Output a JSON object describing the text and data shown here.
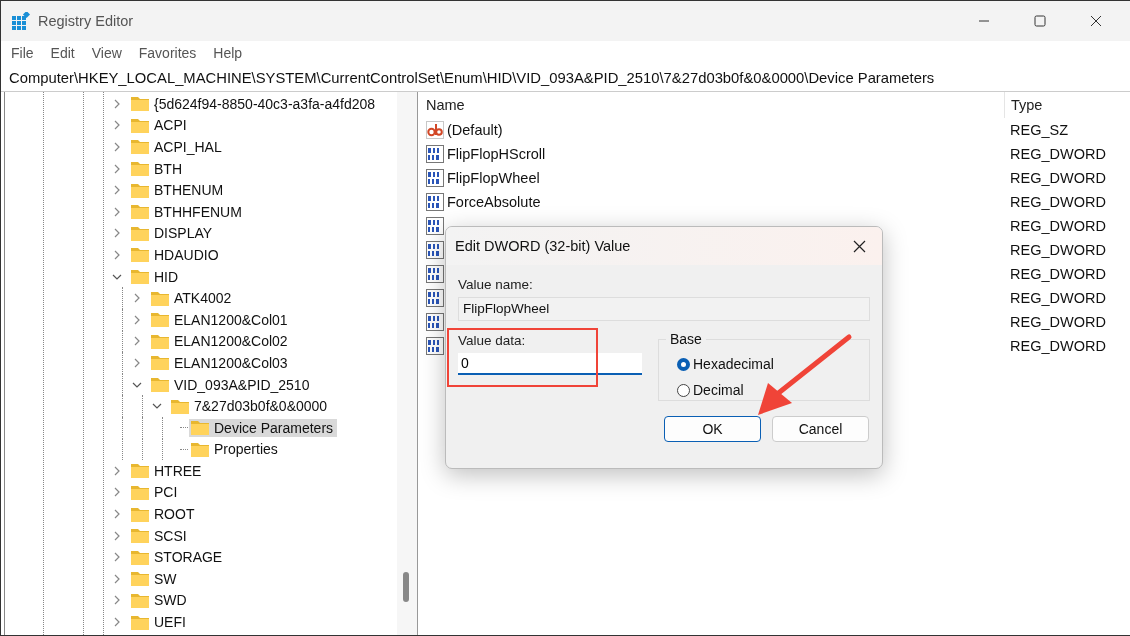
{
  "window": {
    "title": "Registry Editor"
  },
  "menu": [
    "File",
    "Edit",
    "View",
    "Favorites",
    "Help"
  ],
  "address": "Computer\\HKEY_LOCAL_MACHINE\\SYSTEM\\CurrentControlSet\\Enum\\HID\\VID_093A&PID_2510\\7&27d03b0f&0&0000\\Device Parameters",
  "tree": [
    {
      "label": "{5d624f94-8850-40c3-a3fa-a4fd208",
      "expanded": false,
      "selected": false
    },
    {
      "label": "ACPI",
      "expanded": false,
      "selected": false
    },
    {
      "label": "ACPI_HAL",
      "expanded": false,
      "selected": false
    },
    {
      "label": "BTH",
      "expanded": false,
      "selected": false
    },
    {
      "label": "BTHENUM",
      "expanded": false,
      "selected": false
    },
    {
      "label": "BTHHFENUM",
      "expanded": false,
      "selected": false
    },
    {
      "label": "DISPLAY",
      "expanded": false,
      "selected": false
    },
    {
      "label": "HDAUDIO",
      "expanded": false,
      "selected": false
    },
    {
      "label": "HID",
      "expanded": true,
      "selected": false,
      "children": [
        {
          "label": "ATK4002",
          "expanded": false,
          "selected": false
        },
        {
          "label": "ELAN1200&Col01",
          "expanded": false,
          "selected": false
        },
        {
          "label": "ELAN1200&Col02",
          "expanded": false,
          "selected": false
        },
        {
          "label": "ELAN1200&Col03",
          "expanded": false,
          "selected": false
        },
        {
          "label": "VID_093A&PID_2510",
          "expanded": true,
          "selected": false,
          "children": [
            {
              "label": "7&27d03b0f&0&0000",
              "expanded": true,
              "selected": false,
              "children": [
                {
                  "label": "Device Parameters",
                  "selected": true
                },
                {
                  "label": "Properties",
                  "selected": false
                }
              ]
            }
          ]
        }
      ]
    },
    {
      "label": "HTREE",
      "expanded": false,
      "selected": false
    },
    {
      "label": "PCI",
      "expanded": false,
      "selected": false
    },
    {
      "label": "ROOT",
      "expanded": false,
      "selected": false
    },
    {
      "label": "SCSI",
      "expanded": false,
      "selected": false
    },
    {
      "label": "STORAGE",
      "expanded": false,
      "selected": false
    },
    {
      "label": "SW",
      "expanded": false,
      "selected": false
    },
    {
      "label": "SWD",
      "expanded": false,
      "selected": false
    },
    {
      "label": "UEFI",
      "expanded": false,
      "selected": false
    }
  ],
  "values_table": {
    "columns": [
      "Name",
      "Type"
    ],
    "rows": [
      {
        "kind": "string",
        "name": "(Default)",
        "type": "REG_SZ"
      },
      {
        "kind": "dword",
        "name": "FlipFlopHScroll",
        "type": "REG_DWORD"
      },
      {
        "kind": "dword",
        "name": "FlipFlopWheel",
        "type": "REG_DWORD"
      },
      {
        "kind": "dword",
        "name": "ForceAbsolute",
        "type": "REG_DWORD"
      },
      {
        "kind": "dword",
        "type": "REG_DWORD"
      },
      {
        "kind": "dword",
        "type": "REG_DWORD"
      },
      {
        "kind": "dword",
        "type": "REG_DWORD"
      },
      {
        "kind": "dword",
        "type": "REG_DWORD"
      },
      {
        "kind": "dword",
        "type": "REG_DWORD"
      },
      {
        "kind": "dword",
        "type": "REG_DWORD"
      }
    ]
  },
  "dialog": {
    "title": "Edit DWORD (32-bit) Value",
    "value_name_label": "Value name:",
    "value_name": "FlipFlopWheel",
    "value_data_label": "Value data:",
    "value_data": "0",
    "base_label": "Base",
    "base_options": [
      {
        "label": "Hexadecimal",
        "selected": true
      },
      {
        "label": "Decimal",
        "selected": false
      }
    ],
    "buttons": [
      {
        "label": "OK",
        "default": true
      },
      {
        "label": "Cancel",
        "default": false
      }
    ]
  }
}
